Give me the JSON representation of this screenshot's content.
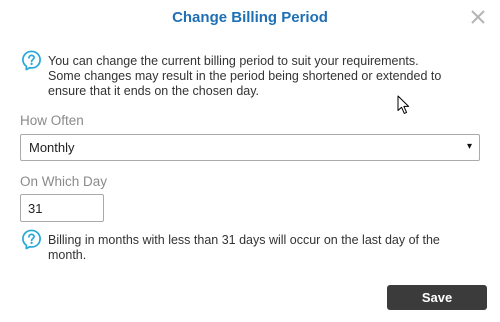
{
  "dialog": {
    "title": "Change Billing Period",
    "close_icon": "close-icon"
  },
  "intro": {
    "icon": "help-bulb-icon",
    "line1": "You can change the current billing period to suit your requirements.",
    "line2": "Some changes may result in the period being shortened or extended to",
    "line3": "ensure that it ends on the chosen day."
  },
  "frequency": {
    "label": "How Often",
    "selected": "Monthly",
    "arrow": "▾"
  },
  "day": {
    "label": "On Which Day",
    "value": "31"
  },
  "note": {
    "icon": "help-bulb-icon",
    "line1": "Billing in months with less than 31 days will occur on the last day of the",
    "line2": "month."
  },
  "actions": {
    "save_label": "Save"
  },
  "colors": {
    "title": "#1f6fb4",
    "icon": "#29a9d9",
    "button": "#3b3b3b"
  }
}
